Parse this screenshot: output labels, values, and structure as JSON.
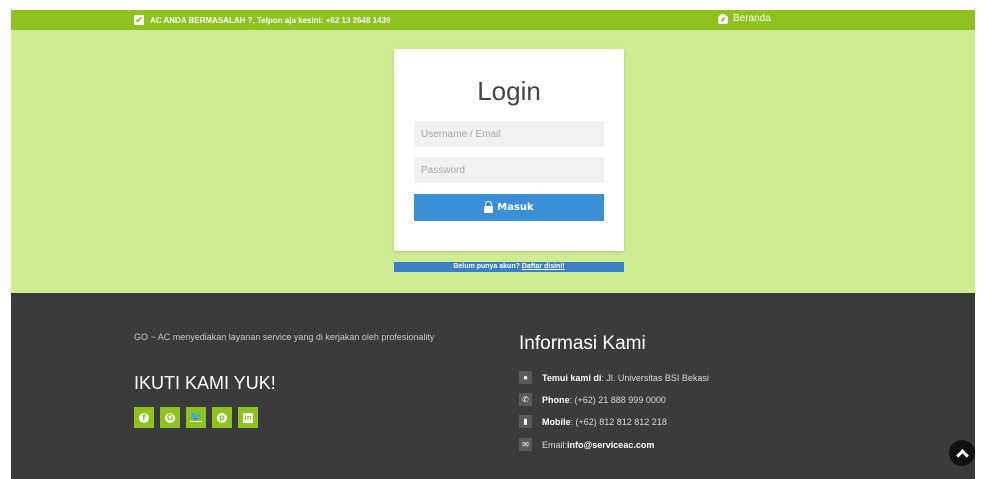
{
  "topbar": {
    "notice": "AC ANDA BERMASALAH ?, Telpon aja kesini: +62 13 2648 1439",
    "home_link": "Beranda"
  },
  "login": {
    "title": "Login",
    "username_placeholder": "Username / Email",
    "password_placeholder": "Password",
    "submit_label": "Masuk",
    "register_prompt": "Belum punya akun?",
    "register_link": "Daftar disini!"
  },
  "footer": {
    "description": "GO ~ AC menyediakan layanan service yang di kerjakan oleh profesionality",
    "follow_title": "IKUTI KAMI YUK!",
    "social": [
      "facebook-icon",
      "google-plus-icon",
      "twitter-icon",
      "pinterest-icon",
      "linkedin-icon"
    ],
    "info_title": "Informasi Kami",
    "address_label": "Temui kami di",
    "address_value": ": Jl. Universitas BSI Bekasi",
    "phone_label": "Phone",
    "phone_value": ": (+62) 21 888 999 0000",
    "mobile_label": "Mobile",
    "mobile_value": ": (+62) 812 812 812 218",
    "email_label": "Email: ",
    "email_value": "info@serviceac.com"
  },
  "colors": {
    "brand_green": "#8dc21f",
    "hero_bg": "#ceec92",
    "button_blue": "#3a8fd6",
    "footer_bg": "#3b3b3b"
  }
}
